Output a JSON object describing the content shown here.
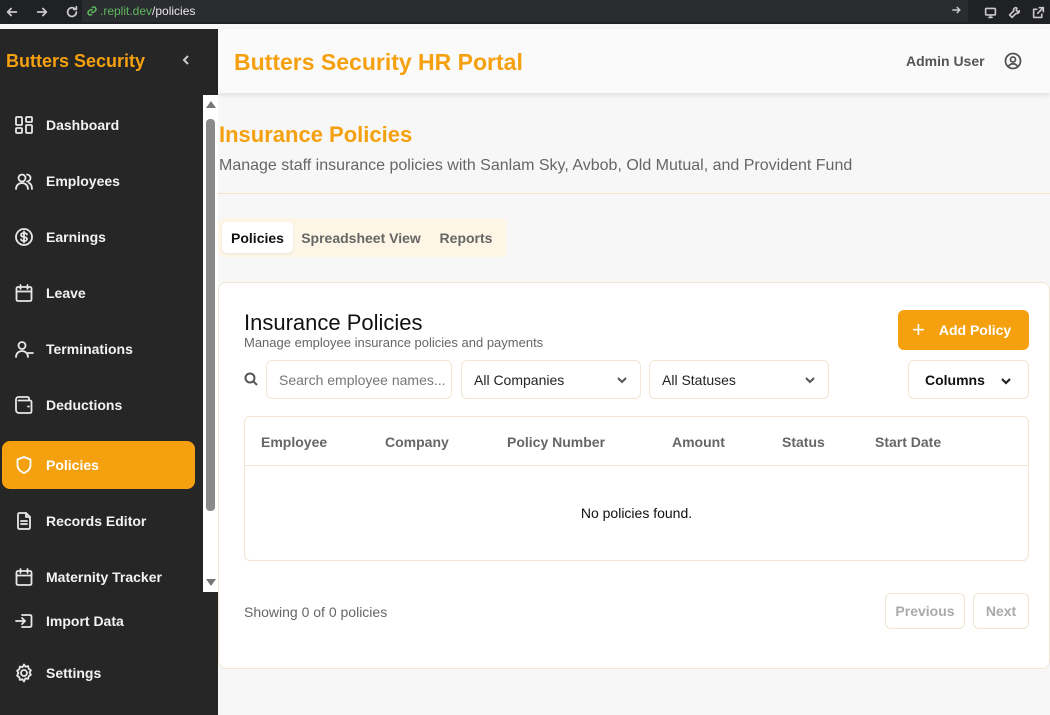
{
  "browser": {
    "url_domain": ".replit.dev",
    "url_path": "/policies"
  },
  "sidebar": {
    "brand": "Butters Security",
    "items": [
      {
        "label": "Dashboard",
        "icon": "dashboard-icon"
      },
      {
        "label": "Employees",
        "icon": "users-icon"
      },
      {
        "label": "Earnings",
        "icon": "dollar-circle-icon"
      },
      {
        "label": "Leave",
        "icon": "calendar-icon"
      },
      {
        "label": "Terminations",
        "icon": "user-minus-icon"
      },
      {
        "label": "Deductions",
        "icon": "wallet-icon"
      },
      {
        "label": "Policies",
        "icon": "shield-icon",
        "active": true
      },
      {
        "label": "Records Editor",
        "icon": "document-icon"
      },
      {
        "label": "Maternity Tracker",
        "icon": "calendar-icon"
      },
      {
        "label": "Import Data",
        "icon": "import-icon"
      },
      {
        "label": "Settings",
        "icon": "gear-icon"
      }
    ]
  },
  "header": {
    "title": "Butters Security HR Portal",
    "user": "Admin User"
  },
  "page": {
    "title": "Insurance Policies",
    "subtitle": "Manage staff insurance policies with Sanlam Sky, Avbob, Old Mutual, and Provident Fund"
  },
  "tabs": [
    "Policies",
    "Spreadsheet View",
    "Reports"
  ],
  "card": {
    "title": "Insurance Policies",
    "subtitle": "Manage employee insurance policies and payments",
    "add_button": "Add Policy",
    "search_placeholder": "Search employee names...",
    "company_filter": "All Companies",
    "status_filter": "All Statuses",
    "columns_button": "Columns"
  },
  "table": {
    "columns": [
      "Employee",
      "Company",
      "Policy Number",
      "Amount",
      "Status",
      "Start Date"
    ],
    "empty_message": "No policies found."
  },
  "pagination": {
    "showing": "Showing 0 of 0 policies",
    "previous": "Previous",
    "next": "Next"
  },
  "colors": {
    "accent": "#f5a00f",
    "sidebar_bg": "#262626"
  }
}
